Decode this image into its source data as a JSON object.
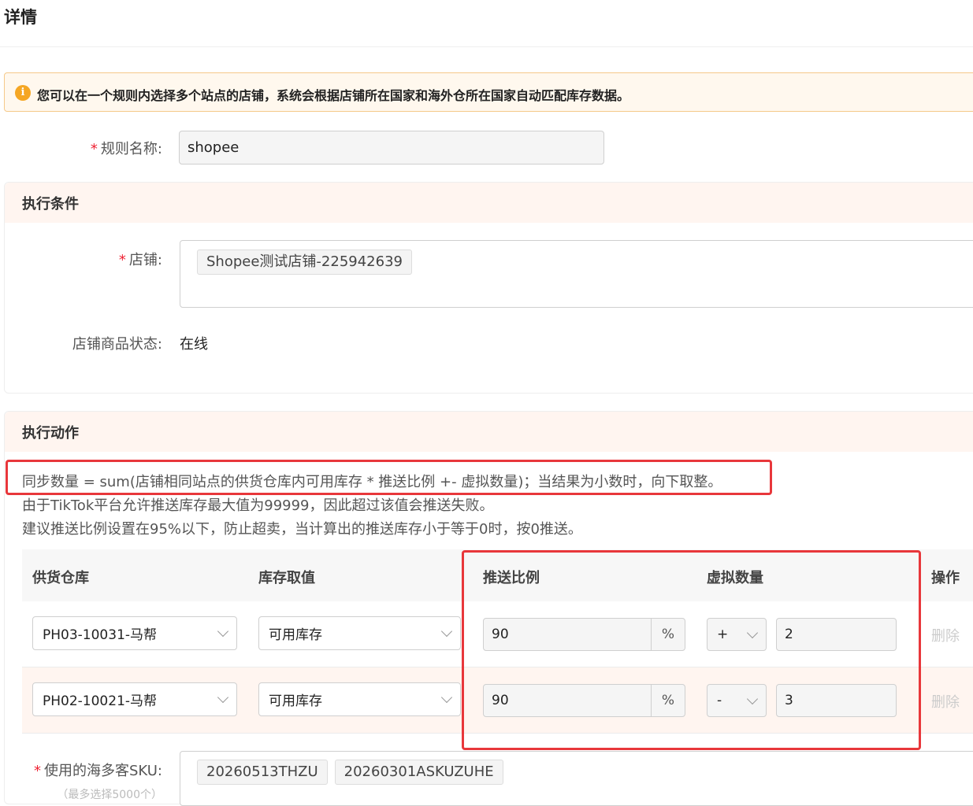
{
  "page": {
    "title": "详情"
  },
  "alert": {
    "icon": "info-icon",
    "icon_glyph": "i",
    "text": "您可以在一个规则内选择多个站点的店铺，系统会根据店铺所在国家和海外仓所在国家自动匹配库存数据。"
  },
  "rule": {
    "required_mark": "*",
    "label": "规则名称:",
    "value": "shopee"
  },
  "condition": {
    "title": "执行条件",
    "store_label": "店铺:",
    "store_tags": [
      "Shopee测试店铺-225942639"
    ],
    "status_label": "店铺商品状态:",
    "status_value": "在线"
  },
  "action": {
    "title": "执行动作",
    "desc": [
      "同步数量 = sum(店铺相同站点的供货仓库内可用库存 * 推送比例 +- 虚拟数量)；当结果为小数时，向下取整。",
      "由于TikTok平台允许推送库存最大值为99999，因此超过该值会推送失败。",
      "建议推送比例设置在95%以下，防止超卖，当计算出的推送库存小于等于0时，按0推送。"
    ],
    "headers": {
      "warehouse": "供货仓库",
      "stock": "库存取值",
      "ratio": "推送比例",
      "virtual": "虚拟数量",
      "op": "操作"
    },
    "rows": [
      {
        "warehouse": "PH03-10031-马帮",
        "stock": "可用库存",
        "ratio": "90",
        "unit": "%",
        "sign": "+",
        "virtual": "2",
        "delete": "删除"
      },
      {
        "warehouse": "PH02-10021-马帮",
        "stock": "可用库存",
        "ratio": "90",
        "unit": "%",
        "sign": "-",
        "virtual": "3",
        "delete": "删除"
      }
    ],
    "sku_label": "使用的海多客SKU:",
    "sku_hint": "（最多选择5000个）",
    "sku_tags": [
      "20260513THZU",
      "20260301ASKUZUHE"
    ]
  },
  "colors": {
    "accent_red": "#e8373b",
    "warning_bg": "#fff8ee",
    "warning_icon": "#f5a623",
    "section_bg": "#fff5f0",
    "row_highlight": "#fff5f0"
  }
}
